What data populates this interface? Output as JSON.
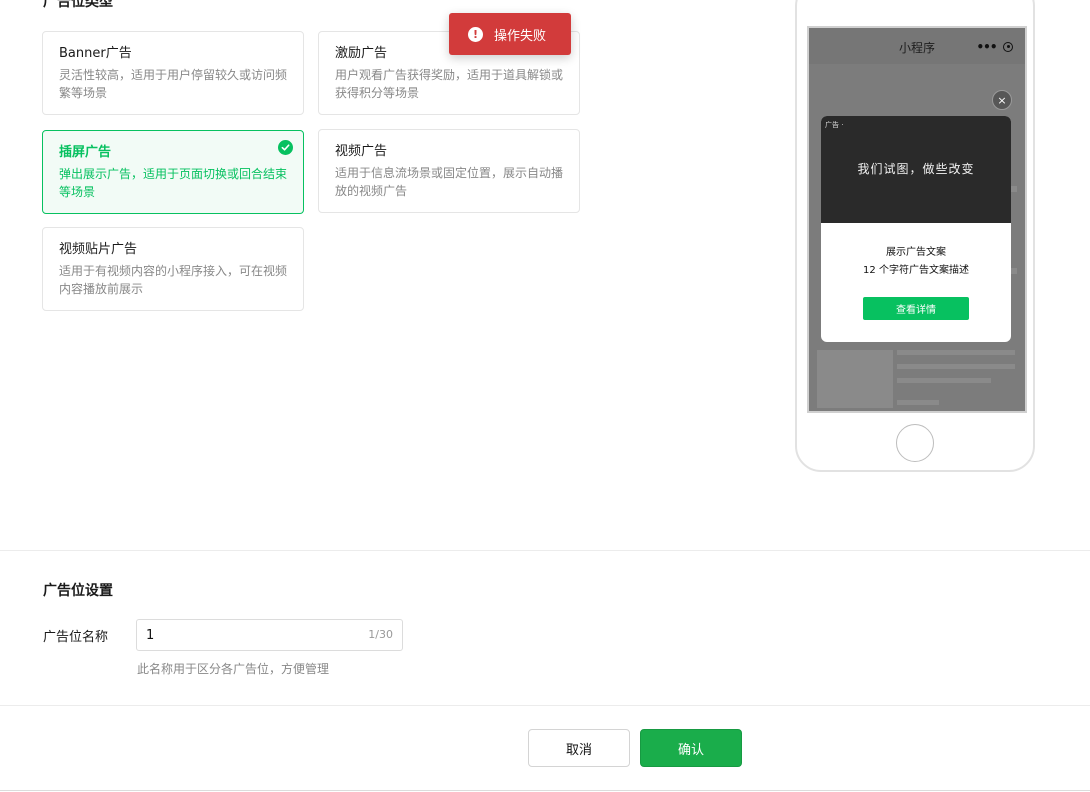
{
  "ad_type_section": {
    "title": "广告位类型"
  },
  "ad_types": [
    {
      "title": "Banner广告",
      "desc": "灵活性较高，适用于用户停留较久或访问频繁等场景",
      "selected": false
    },
    {
      "title": "激励广告",
      "desc": "用户观看广告获得奖励，适用于道具解锁或获得积分等场景",
      "selected": false
    },
    {
      "title": "插屏广告",
      "desc": "弹出展示广告，适用于页面切换或回合结束等场景",
      "selected": true
    },
    {
      "title": "视频广告",
      "desc": "适用于信息流场景或固定位置，展示自动播放的视频广告",
      "selected": false
    },
    {
      "title": "视频贴片广告",
      "desc": "适用于有视频内容的小程序接入，可在视频内容播放前展示",
      "selected": false
    }
  ],
  "toast": {
    "text": "操作失败",
    "icon": "exclamation-icon",
    "color": "#d23b3b"
  },
  "preview": {
    "nav_title": "小程序",
    "close_label": "×",
    "ad_tag": "广告 ·",
    "banner_text": "我们试图，做些改变",
    "popup_title": "展示广告文案",
    "popup_desc": "12 个字符广告文案描述",
    "popup_button": "查看详情"
  },
  "settings": {
    "title": "广告位设置",
    "name_label": "广告位名称",
    "name_value": "1",
    "name_counter": "1/30",
    "name_hint": "此名称用于区分各广告位，方便管理"
  },
  "actions": {
    "cancel": "取消",
    "confirm": "确认"
  },
  "colors": {
    "accent": "#07c160",
    "error": "#d23b3b"
  }
}
